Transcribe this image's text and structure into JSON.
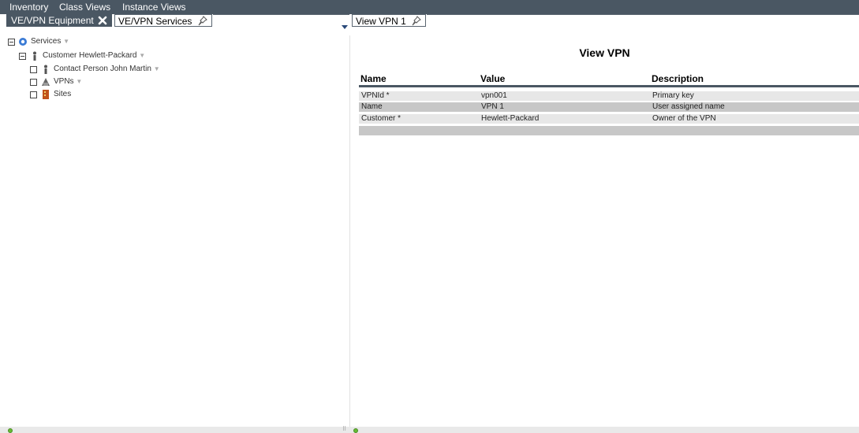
{
  "menu": {
    "items": [
      "Inventory",
      "Class Views",
      "Instance Views"
    ]
  },
  "tabs": {
    "left": [
      {
        "label": "VE/VPN Equipment",
        "icon": "close-icon",
        "active": true
      },
      {
        "label": "VE/VPN Services",
        "icon": "pin-icon",
        "active": false
      }
    ],
    "right": [
      {
        "label": "View VPN 1",
        "icon": "pin-icon",
        "active": false
      }
    ],
    "overflow_icon": "dropdown-arrow-icon"
  },
  "tree": {
    "nodes": [
      {
        "label": "Services",
        "icon": "services-icon",
        "has_menu": true
      },
      {
        "label": "Customer Hewlett-Packard",
        "icon": "person-icon",
        "has_menu": true
      },
      {
        "label": "Contact Person John Martin",
        "icon": "person-icon",
        "has_menu": true
      },
      {
        "label": "VPNs",
        "icon": "vpn-icon",
        "has_menu": true
      },
      {
        "label": "Sites",
        "icon": "sites-icon",
        "has_menu": false
      }
    ]
  },
  "view": {
    "title": "View VPN",
    "columns": [
      "Name",
      "Value",
      "Description"
    ],
    "rows": [
      [
        "VPNId *",
        "vpn001",
        "Primary key"
      ],
      [
        "Name",
        "VPN 1",
        "User assigned name"
      ],
      [
        "Customer *",
        "Hewlett-Packard",
        "Owner of the VPN"
      ]
    ]
  },
  "colors": {
    "header_bg": "#4a5763",
    "row_light": "#e7e7e7",
    "row_dark": "#c7c7c7",
    "status_icon": "#66bb33"
  }
}
